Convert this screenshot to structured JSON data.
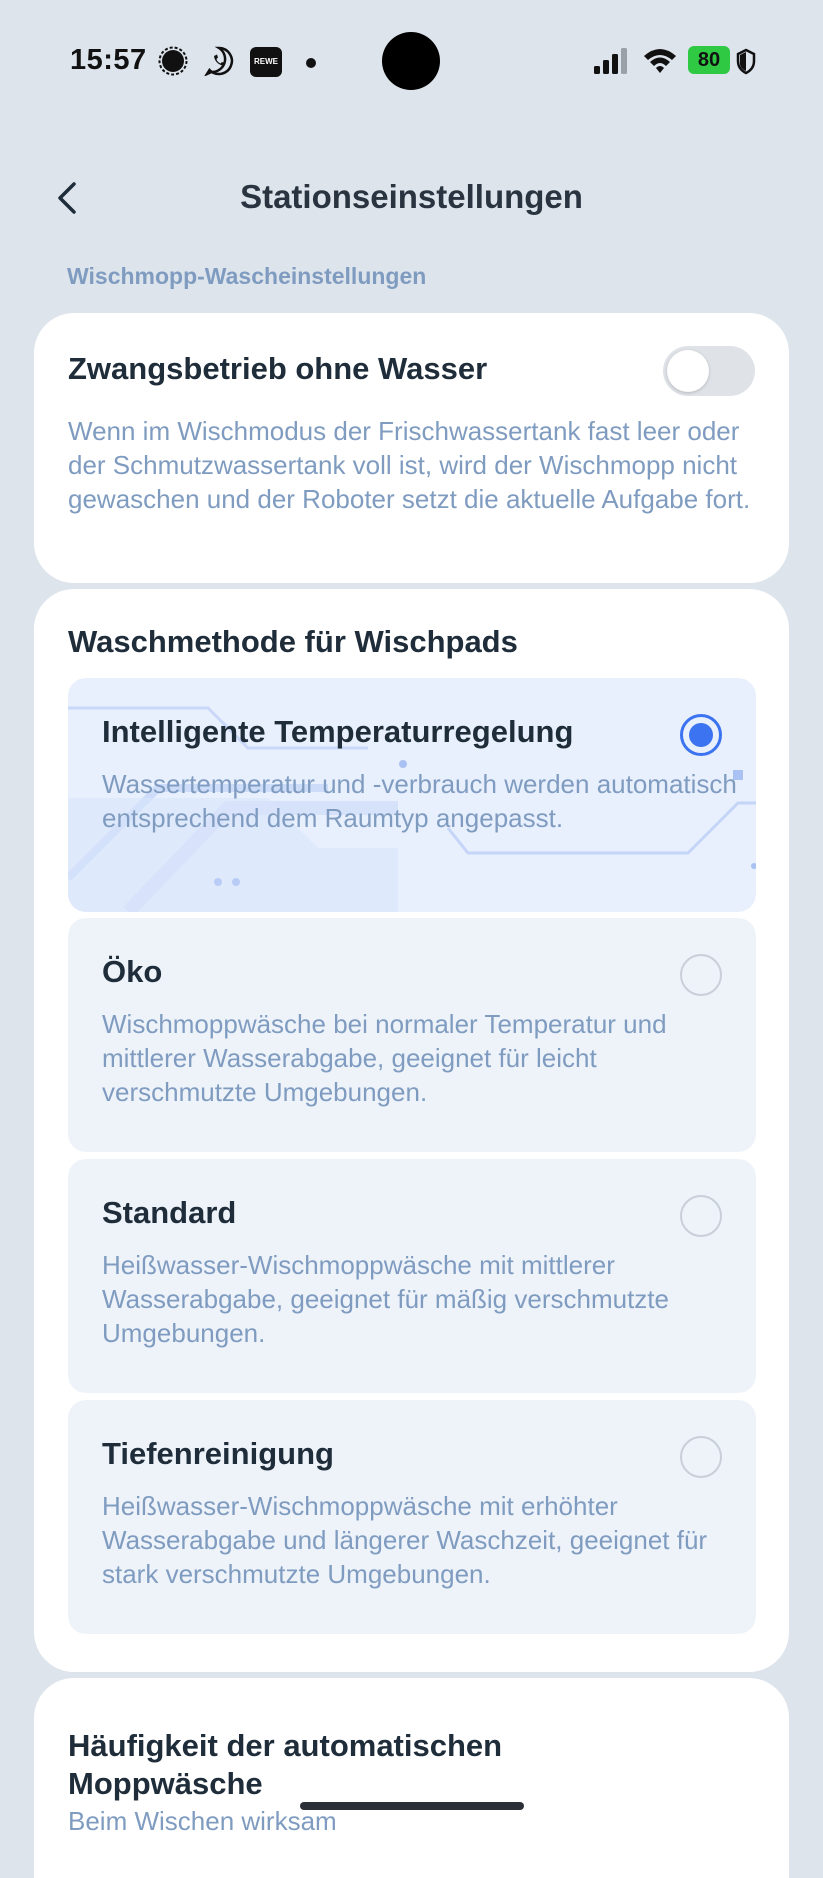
{
  "status_bar": {
    "time": "15:57",
    "notification_icons": [
      "signal-app-icon",
      "whatsapp-icon",
      "rewe-icon",
      "dot-icon"
    ],
    "rewe_label": "REWE",
    "battery": "80",
    "right_icons": [
      "cellular-signal-icon",
      "wifi-icon",
      "battery-icon",
      "shield-icon"
    ]
  },
  "header": {
    "back_icon": "chevron-left-icon",
    "title": "Stationseinstellungen"
  },
  "section_label": "Wischmopp-Wascheinstellungen",
  "force_mode": {
    "title": "Zwangsbetrieb ohne Wasser",
    "description": "Wenn im Wischmodus der Frischwassertank fast leer oder der Schmutzwassertank voll ist, wird der Wischmopp nicht gewaschen und der Roboter setzt die aktuelle Aufgabe fort.",
    "enabled": false
  },
  "wash_method": {
    "title": "Waschmethode für Wischpads",
    "options": [
      {
        "label": "Intelligente Temperaturregelung",
        "description": "Wassertemperatur und -verbrauch werden automatisch entsprechend dem Raumtyp angepasst.",
        "selected": true
      },
      {
        "label": "Öko",
        "description": "Wischmoppwäsche bei normaler Temperatur und mittlerer Wasserabgabe, geeignet für leicht verschmutzte Umgebungen.",
        "selected": false
      },
      {
        "label": "Standard",
        "description": "Heißwasser-Wischmoppwäsche mit mittlerer Wasserabgabe, geeignet für mäßig verschmutzte Umgebungen.",
        "selected": false
      },
      {
        "label": "Tiefenreinigung",
        "description": "Heißwasser-Wischmoppwäsche mit erhöhter Wasserabgabe und längerer Waschzeit, geeignet für stark verschmutzte Umgebungen.",
        "selected": false
      }
    ]
  },
  "auto_wash": {
    "title": "Häufigkeit der automatischen Moppwäsche",
    "subtitle": "Beim Wischen wirksam"
  },
  "colors": {
    "accent": "#3b73f0",
    "background": "#dde4ec",
    "secondary_text": "#7f9cc0",
    "battery": "#2fc944"
  }
}
